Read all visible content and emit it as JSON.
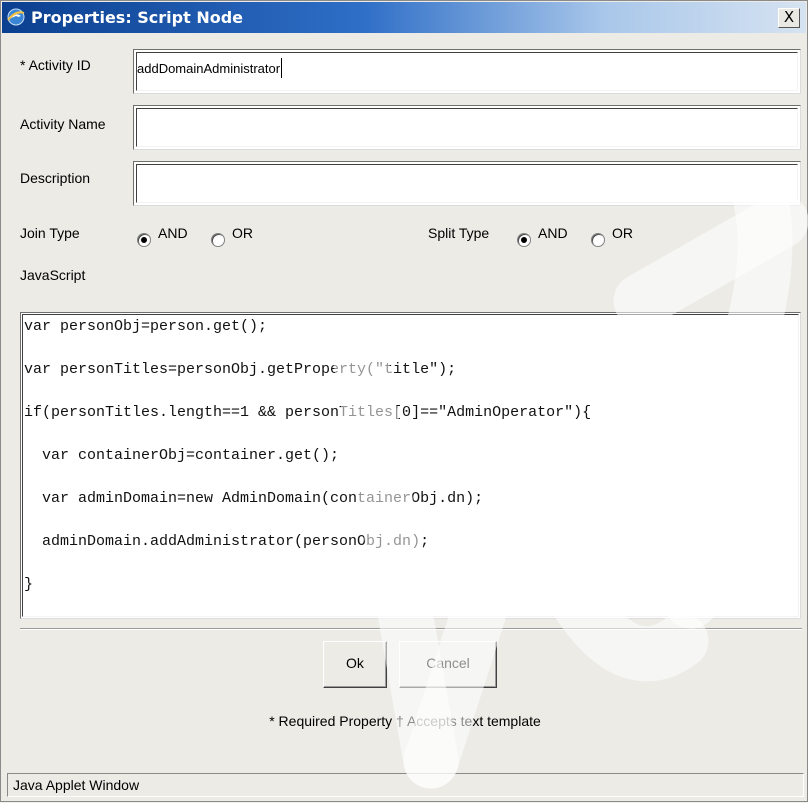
{
  "window": {
    "title": "Properties: Script Node",
    "close_glyph": "X"
  },
  "form": {
    "activity_id": {
      "label": "* Activity ID",
      "value": "addDomainAdministrator"
    },
    "activity_name": {
      "label": "Activity Name",
      "value": ""
    },
    "description": {
      "label": "Description",
      "value": ""
    },
    "join_type": {
      "label": "Join Type",
      "options": [
        "AND",
        "OR"
      ],
      "selected": "AND"
    },
    "split_type": {
      "label": "Split Type",
      "options": [
        "AND",
        "OR"
      ],
      "selected": "AND"
    },
    "javascript_label": "JavaScript"
  },
  "script": {
    "lines": [
      "var personObj=person.get();",
      "var personTitles=personObj.getProperty(\"title\");",
      "if(personTitles.length==1 && personTitles[0]==\"AdminOperator\"){",
      "  var containerObj=container.get();",
      "  var adminDomain=new AdminDomain(containerObj.dn);",
      "  adminDomain.addAdministrator(personObj.dn);",
      "}"
    ]
  },
  "buttons": {
    "ok": "Ok",
    "cancel": "Cancel"
  },
  "footnote": "* Required Property  † Accepts text template",
  "status_bar": "Java Applet Window"
}
